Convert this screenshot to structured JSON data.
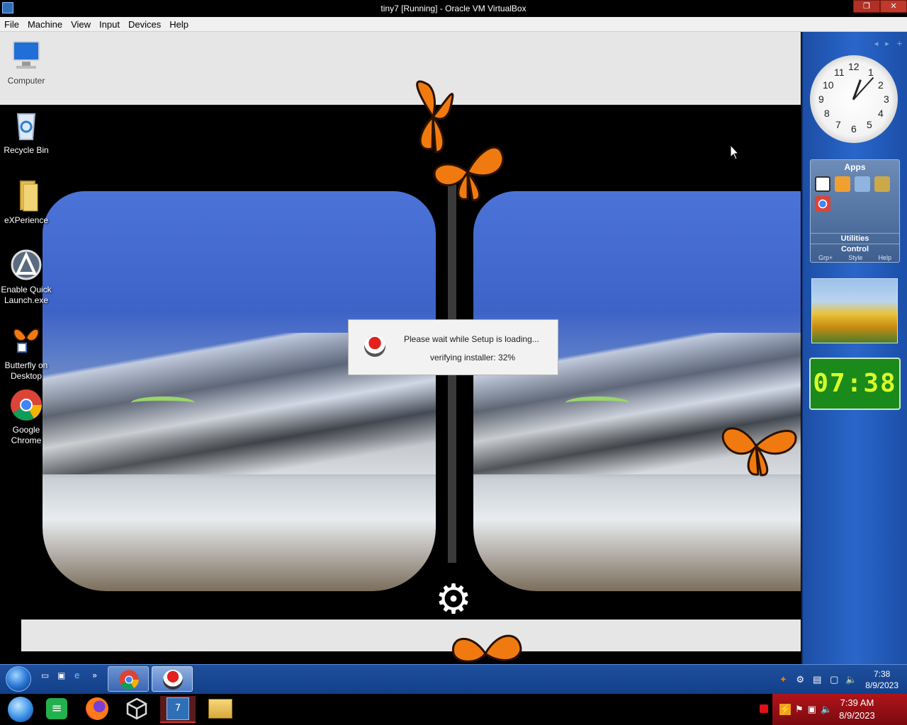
{
  "host_window": {
    "title": "tiny7 [Running] - Oracle VM VirtualBox",
    "menu": [
      "File",
      "Machine",
      "View",
      "Input",
      "Devices",
      "Help"
    ]
  },
  "desktop_icons": [
    {
      "label": "Computer"
    },
    {
      "label": "Recycle Bin"
    },
    {
      "label": "eXPerience"
    },
    {
      "label": "Enable Quick Launch.exe"
    },
    {
      "label": "Butterfly on Desktop"
    },
    {
      "label": "Google Chrome"
    }
  ],
  "setup_dialog": {
    "message": "Please wait while Setup is loading...",
    "progress_text": "verifying installer: 32%",
    "progress_value": 0.32
  },
  "sidebar": {
    "analog_clock": {
      "numbers": [
        "12",
        "1",
        "2",
        "3",
        "4",
        "5",
        "6",
        "7",
        "8",
        "9",
        "10",
        "11"
      ]
    },
    "apps_gadget": {
      "title": "Apps",
      "rows": [
        "Utilities",
        "Control"
      ],
      "footer": [
        "Grp+",
        "Style",
        "Help"
      ]
    },
    "digital_clock": "07:38"
  },
  "guest_taskbar": {
    "time": "7:38",
    "date": "8/9/2023",
    "overflow_chevron": "»"
  },
  "host_taskbar": {
    "time": "7:39 AM",
    "date": "8/9/2023"
  },
  "colors": {
    "sidebar_blue": "#2a66c9",
    "digital_clock_green": "#1a8a1a",
    "host_tray_red": "#b0141a",
    "butterfly_orange": "#f07a10"
  }
}
